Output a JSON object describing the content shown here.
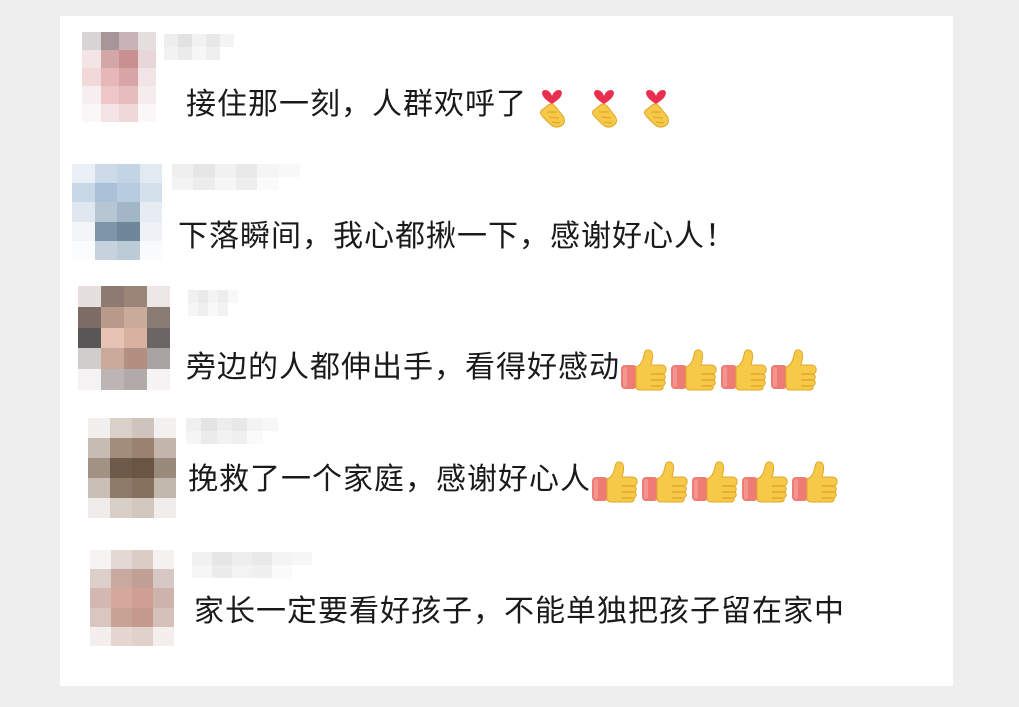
{
  "colors": {
    "background": "#eeeeee",
    "panel": "#ffffff",
    "text": "#1a1a1a",
    "thumb_skin": "#f7c948",
    "thumb_sleeve": "#ee7b74",
    "heart": "#e8304e"
  },
  "comments": [
    {
      "text": "接住那一刻，人群欢呼了",
      "emoji": "finger-heart-icon",
      "emoji_count": 3,
      "avatar_palette": [
        "#d9d4d6",
        "#a89598",
        "#c8b4b6",
        "#e6dfe0",
        "#f3e4e6",
        "#d3a6a8",
        "#c89090",
        "#e9d6d8",
        "#f1d9da",
        "#e6b6b8",
        "#d8a4a6",
        "#f2e3e4",
        "#f6eef0",
        "#efc6c8",
        "#e6bcbf",
        "#f5ecee",
        "#fbf7f8",
        "#f4e3e5",
        "#efd7da",
        "#fbf7f8"
      ],
      "name_palette": [
        "#eeeeee",
        "#e2e2e2",
        "#f2f2f2",
        "#e8e8e8",
        "#f4f4f4",
        "#ffffff",
        "#f2f2f2",
        "#ebebeb",
        "#f7f7f7",
        "#efefef",
        "#ffffff",
        "#ffffff"
      ]
    },
    {
      "text": "下落瞬间，我心都揪一下，感谢好心人！",
      "emoji": "",
      "emoji_count": 0,
      "avatar_palette": [
        "#eaf0f6",
        "#cddbe8",
        "#c3d4e5",
        "#e1e9f1",
        "#c9d8e7",
        "#aac0d6",
        "#b7cbe0",
        "#d3e0ec",
        "#dfe8f1",
        "#b7c6d3",
        "#a3b6c7",
        "#e6ecf2",
        "#f2f6f9",
        "#7d95a8",
        "#6f879b",
        "#eef2f6",
        "#fafcfd",
        "#c6d3de",
        "#bccbd8",
        "#f9fbfc"
      ],
      "name_palette": [
        "#efefef",
        "#e6e6e6",
        "#f1f1f1",
        "#e9e9e9",
        "#f5f5f5",
        "#f8f8f8",
        "#f3f3f3",
        "#ececec",
        "#f6f6f6",
        "#eeeeee",
        "#fafafa",
        "#ffffff"
      ]
    },
    {
      "text": "旁边的人都伸出手，看得好感动",
      "emoji": "thumbs-up-icon",
      "emoji_count": 4,
      "avatar_palette": [
        "#e5e0de",
        "#8e7a70",
        "#9a8478",
        "#ece7e5",
        "#7d6c66",
        "#b79a8a",
        "#c9ab9a",
        "#8a7a74",
        "#585656",
        "#e7c3b4",
        "#d9b1a1",
        "#6b6564",
        "#d1cdcd",
        "#caa999",
        "#b28f80",
        "#a9a3a1",
        "#f4f2f2",
        "#bdb5b3",
        "#b2aaa8",
        "#f5f3f3"
      ],
      "name_palette": [
        "#f0f0f0",
        "#eaeaea",
        "#f3f3f3",
        "#ededed",
        "#f8f8f8",
        "#ffffff",
        "#f5f5f5",
        "#efefef",
        "#f8f8f8",
        "#f2f2f2",
        "#ffffff",
        "#ffffff"
      ]
    },
    {
      "text": "挽救了一个家庭，感谢好心人",
      "emoji": "thumbs-up-icon",
      "emoji_count": 5,
      "avatar_palette": [
        "#f2f0ef",
        "#d9d0ca",
        "#cfc4bd",
        "#f3f1f0",
        "#c7bcb4",
        "#a28c7b",
        "#9a8270",
        "#c2b6ad",
        "#a29283",
        "#6e5a4b",
        "#6a5444",
        "#998a7c",
        "#c9bfb6",
        "#8e7a69",
        "#86715f",
        "#c3b8ae",
        "#f0ecea",
        "#d8cfc8",
        "#d2c8c0",
        "#f1edea"
      ],
      "name_palette": [
        "#f0f0f0",
        "#e4e4e4",
        "#ededed",
        "#e8e8e8",
        "#f3f3f3",
        "#f7f7f7",
        "#f5f5f5",
        "#ebebeb",
        "#f2f2f2",
        "#efefef",
        "#fafafa",
        "#ffffff"
      ]
    },
    {
      "text": "家长一定要看好孩子，不能单独把孩子留在家中",
      "emoji": "",
      "emoji_count": 0,
      "avatar_palette": [
        "#f6f3f2",
        "#e4d8d4",
        "#dcccc6",
        "#f5f1f0",
        "#dccfca",
        "#c8a99f",
        "#c09f94",
        "#d8c8c3",
        "#d2b8b0",
        "#d6a79c",
        "#cf9f94",
        "#cdb3ab",
        "#d9c6c0",
        "#c9a296",
        "#c4998e",
        "#d6c1ba",
        "#f4efed",
        "#e5d6d1",
        "#e1d1cb",
        "#f4eeec"
      ],
      "name_palette": [
        "#f1f1f1",
        "#e6e6e6",
        "#eeeeee",
        "#e9e9e9",
        "#f4f4f4",
        "#f7f7f7",
        "#f6f6f6",
        "#ececec",
        "#f3f3f3",
        "#f0f0f0",
        "#fafafa",
        "#ffffff"
      ]
    }
  ]
}
